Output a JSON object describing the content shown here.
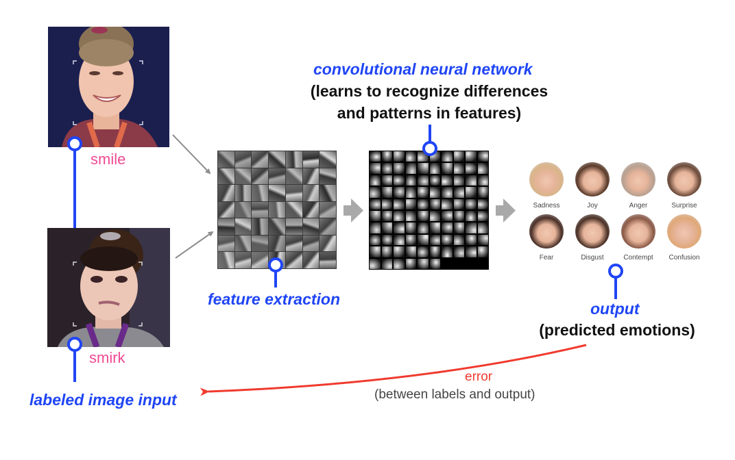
{
  "inputs": {
    "title": "labeled image input",
    "images": [
      {
        "label": "smile",
        "description": "smiling face photo"
      },
      {
        "label": "smirk",
        "description": "smirking face photo"
      }
    ]
  },
  "feature_extraction": {
    "title": "feature extraction",
    "grid_rows": 7,
    "grid_cols": 7
  },
  "cnn": {
    "title": "convolutional neural network",
    "subtitle_line1": "(learns to recognize differences",
    "subtitle_line2": "and patterns in features)",
    "grid_rows": 10,
    "grid_cols": 10,
    "last_row_filled": 6
  },
  "output": {
    "title": "output",
    "subtitle": "(predicted emotions)",
    "emotions": [
      {
        "name": "Sadness",
        "color": "#d9b48a"
      },
      {
        "name": "Joy",
        "color": "#5a3a2a"
      },
      {
        "name": "Anger",
        "color": "#b8a090"
      },
      {
        "name": "Surprise",
        "color": "#6b4a3a"
      },
      {
        "name": "Fear",
        "color": "#4a3028"
      },
      {
        "name": "Disgust",
        "color": "#4a3026"
      },
      {
        "name": "Contempt",
        "color": "#8a5a48"
      },
      {
        "name": "Confusion",
        "color": "#e0a878"
      }
    ]
  },
  "error": {
    "label": "error",
    "description": "(between labels and output)"
  },
  "colors": {
    "accent_blue": "#1f45f5",
    "label_pink": "#f04a93",
    "error_red": "#f03a2e",
    "arrow_gray": "#a9a9a9"
  }
}
